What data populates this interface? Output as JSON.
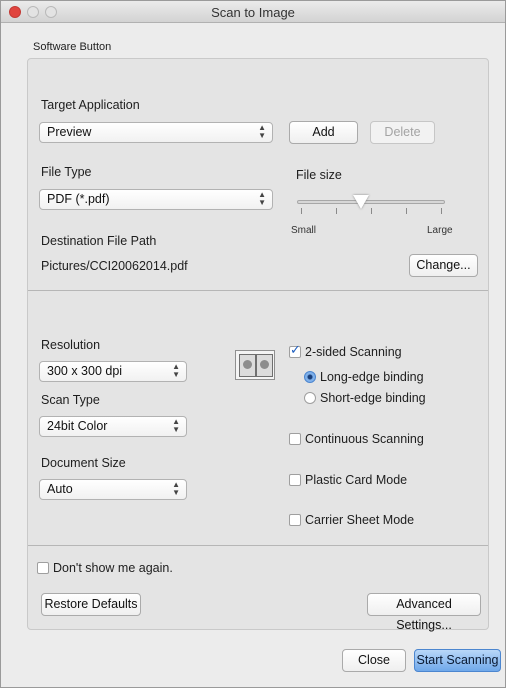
{
  "window": {
    "title": "Scan to Image"
  },
  "group": {
    "label": "Software Button"
  },
  "target_application": {
    "label": "Target Application",
    "selected": "Preview",
    "add_label": "Add",
    "delete_label": "Delete"
  },
  "file_type": {
    "label": "File Type",
    "selected": "PDF (*.pdf)"
  },
  "file_size": {
    "label": "File size",
    "min_label": "Small",
    "max_label": "Large",
    "level": 0.43
  },
  "destination": {
    "label": "Destination File Path",
    "path": "Pictures/CCI20062014.pdf",
    "change_label": "Change..."
  },
  "resolution": {
    "label": "Resolution",
    "selected": "300 x 300 dpi"
  },
  "scan_type": {
    "label": "Scan Type",
    "selected": "24bit Color"
  },
  "document_size": {
    "label": "Document Size",
    "selected": "Auto"
  },
  "options": {
    "two_sided": {
      "label": "2-sided Scanning",
      "checked": true
    },
    "long_edge": {
      "label": "Long-edge binding",
      "selected": true
    },
    "short_edge": {
      "label": "Short-edge binding",
      "selected": false
    },
    "continuous": {
      "label": "Continuous Scanning",
      "checked": false
    },
    "plastic_card": {
      "label": "Plastic Card Mode",
      "checked": false
    },
    "carrier_sheet": {
      "label": "Carrier Sheet Mode",
      "checked": false
    }
  },
  "dont_show": {
    "label": "Don't show me again.",
    "checked": false
  },
  "buttons": {
    "restore_defaults": "Restore Defaults",
    "advanced_settings": "Advanced Settings...",
    "close": "Close",
    "start_scanning": "Start Scanning"
  },
  "colors": {
    "accent": "#6fa8ea",
    "close_dot": "#e0443e"
  },
  "icons": {
    "duplex": "duplex-scan-icon",
    "popup_arrows": "up-down-arrows-icon"
  }
}
